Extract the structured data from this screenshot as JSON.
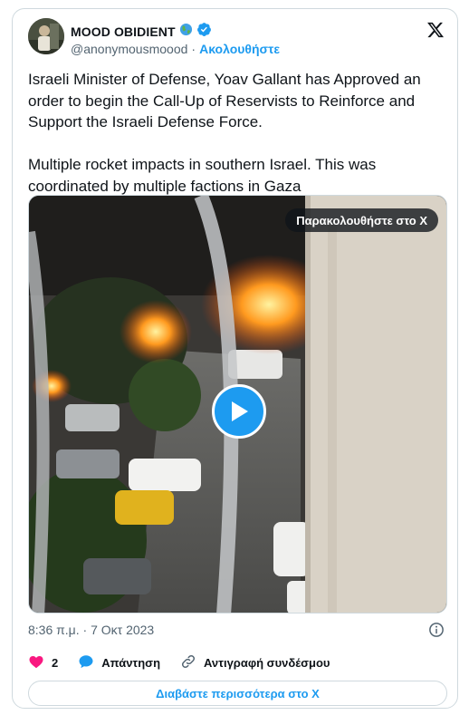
{
  "author": {
    "display_name": "MOOD OBIDIENT",
    "handle": "@anonymousmoood",
    "separator": "·",
    "follow_label": "Ακολουθήστε"
  },
  "tweet": {
    "text": "Israeli Minister of Defense, Yoav Gallant has Approved an order to begin the Call-Up of Reservists to Reinforce and Support the Israeli Defense Force.\n\nMultiple rocket impacts in southern Israel. This was coordinated by multiple factions in Gaza",
    "timestamp": "8:36 π.μ. · 7 Οκτ 2023"
  },
  "media": {
    "watch_label": "Παρακολουθήστε στο X"
  },
  "actions": {
    "like_count": "2",
    "reply_label": "Απάντηση",
    "copy_link_label": "Αντιγραφή συνδέσμου",
    "read_more_label": "Διαβάστε περισσότερα στο X"
  },
  "colors": {
    "accent": "#1d9bf0",
    "like": "#f91880",
    "text": "#0f1419",
    "muted": "#536471",
    "border": "#cfd9de"
  },
  "icons": [
    "globe-emoji-icon",
    "verified-badge-icon",
    "x-logo-icon",
    "play-icon",
    "info-icon",
    "heart-icon",
    "reply-bubble-icon",
    "link-icon"
  ]
}
